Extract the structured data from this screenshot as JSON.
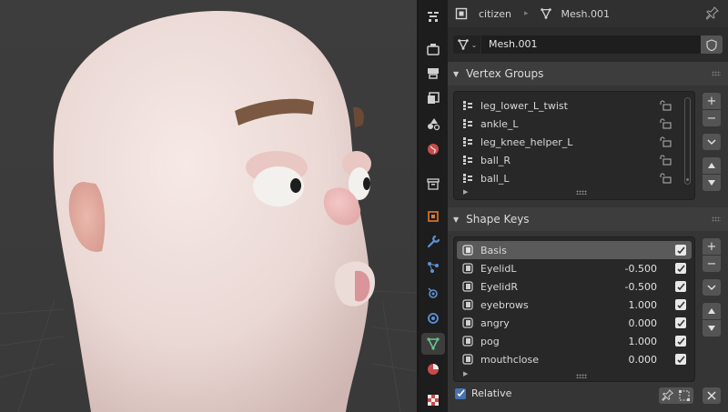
{
  "context": {
    "object_name": "citizen",
    "mesh_name": "Mesh.001"
  },
  "mesh_data": {
    "name": "Mesh.001"
  },
  "vertex_groups": {
    "header": "Vertex Groups",
    "items": [
      {
        "name": "leg_lower_L_twist"
      },
      {
        "name": "ankle_L"
      },
      {
        "name": "leg_knee_helper_L"
      },
      {
        "name": "ball_R"
      },
      {
        "name": "ball_L"
      }
    ]
  },
  "shape_keys": {
    "header": "Shape Keys",
    "items": [
      {
        "name": "Basis",
        "value": "",
        "checked": true,
        "selected": true
      },
      {
        "name": "EyelidL",
        "value": "-0.500",
        "checked": true
      },
      {
        "name": "EyelidR",
        "value": "-0.500",
        "checked": true
      },
      {
        "name": "eyebrows",
        "value": "1.000",
        "checked": true
      },
      {
        "name": "angry",
        "value": "0.000",
        "checked": true
      },
      {
        "name": "pog",
        "value": "1.000",
        "checked": true
      },
      {
        "name": "mouthclose",
        "value": "0.000",
        "checked": true
      }
    ],
    "relative_label": "Relative",
    "relative_checked": true
  },
  "side_buttons": {
    "add": "+",
    "remove": "−"
  },
  "tabs": [
    "tool-icon",
    "render-icon",
    "output-icon",
    "view-layer-icon",
    "scene-icon",
    "world-icon",
    "collection-icon",
    "object-icon",
    "modifier-icon",
    "particles-icon",
    "physics-icon",
    "constraints-icon",
    "object-data-icon",
    "material-icon",
    "texture-icon"
  ],
  "colors": {
    "accent": "#4772b3",
    "active_tab_icon": "#68c38f"
  }
}
